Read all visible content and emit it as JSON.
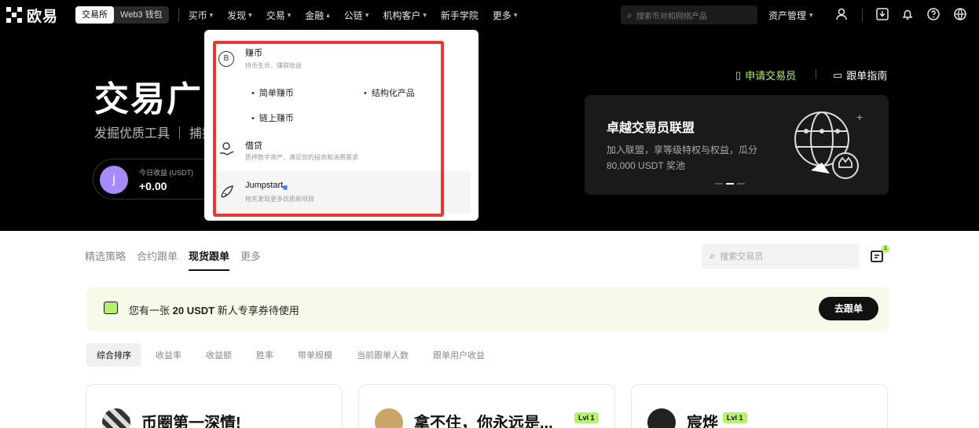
{
  "topbar": {
    "logo_text": "欧易",
    "mode_switch": [
      "交易所",
      "Web3 钱包"
    ],
    "nav": [
      {
        "label": "买币",
        "has_menu": true
      },
      {
        "label": "发现",
        "has_menu": true
      },
      {
        "label": "交易",
        "has_menu": true
      },
      {
        "label": "金融",
        "has_menu": true,
        "open": true
      },
      {
        "label": "公链",
        "has_menu": true
      },
      {
        "label": "机构客户",
        "has_menu": true
      },
      {
        "label": "新手学院",
        "has_menu": false
      },
      {
        "label": "更多",
        "has_menu": true
      }
    ],
    "search_placeholder": "搜索币对和网络产品",
    "asset_label": "资产管理"
  },
  "hero": {
    "title": "交易广",
    "subtitle": "发掘优质工具 ｜ 捕捉",
    "avatar_letter": "j",
    "earnings_label": "今日收益 (USDT)",
    "earnings_value": "+0.00",
    "apply_label": "申请交易员",
    "guide_label": "跟单指南",
    "alliance": {
      "title": "卓越交易员联盟",
      "desc": "加入联盟，享等级特权与权益，瓜分 80,000 USDT 奖池"
    }
  },
  "dropdown": {
    "items": [
      {
        "title": "赚币",
        "desc": "持币生币，赚取收益",
        "icon": "coin-icon"
      },
      {
        "title": "借贷",
        "desc": "质押数字资产，满足您的投资和消费需求",
        "icon": "loan-icon"
      },
      {
        "title": "Jumpstart",
        "desc": "抢先发现更多优质新项目",
        "icon": "rocket-icon"
      }
    ],
    "sub_links": [
      "简单赚币",
      "结构化产品",
      "链上赚币"
    ]
  },
  "tabs": [
    "精选策略",
    "合约跟单",
    "现货跟单",
    "更多"
  ],
  "active_tab": "现货跟单",
  "search2_placeholder": "搜索交易员",
  "cart_badge": "1",
  "banner": {
    "prefix": "您有一张 ",
    "amount": "20 USDT",
    "suffix": " 新人专享券待使用",
    "button": "去跟单"
  },
  "sorts": [
    "综合排序",
    "收益率",
    "收益额",
    "胜率",
    "带单规模",
    "当前跟单人数",
    "跟单用户收益"
  ],
  "cards": [
    {
      "name": "币圈第一深情!",
      "level": ""
    },
    {
      "name": "拿不住，你永远是...",
      "level": "Lvl 1"
    },
    {
      "name": "宸烨",
      "level": "Lvl 1"
    }
  ],
  "colors": {
    "accent": "#b7f06b",
    "highlight_box": "#e53935",
    "hero_bg": "#000000"
  }
}
